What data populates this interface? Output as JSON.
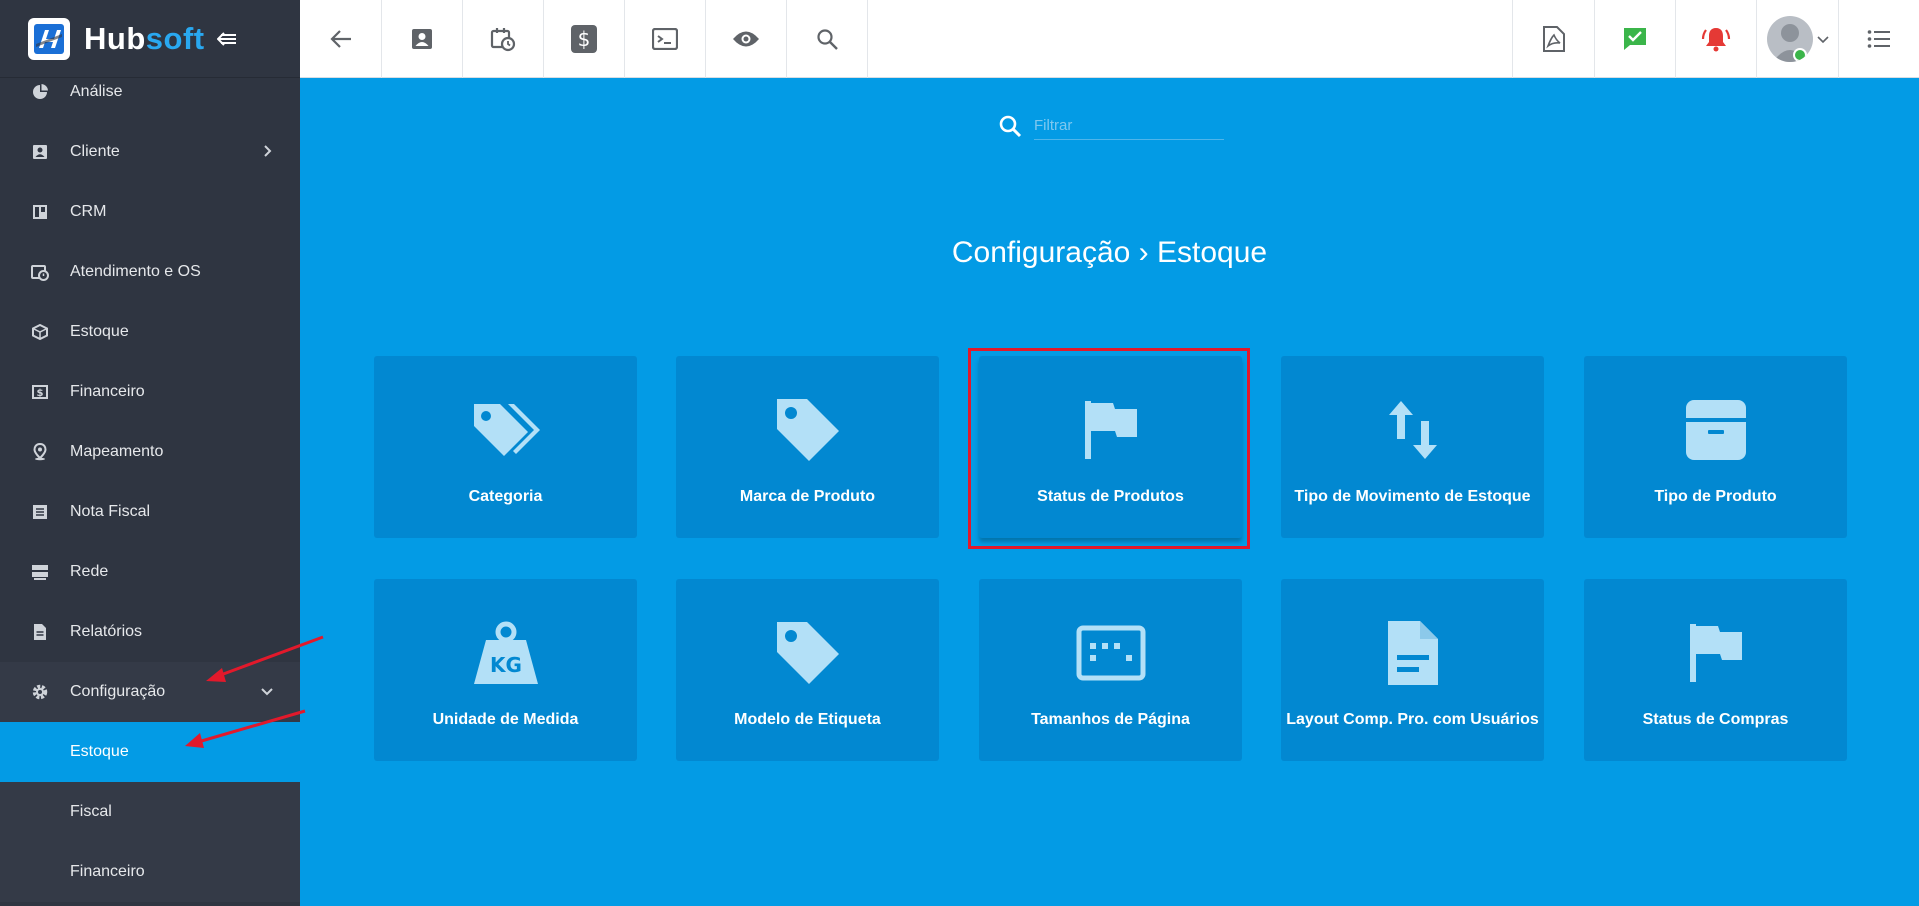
{
  "brand": {
    "hub": "Hub",
    "soft": "soft"
  },
  "sidebar": {
    "items": [
      {
        "label": "Análise",
        "icon": "pie-chart-icon"
      },
      {
        "label": "Cliente",
        "icon": "contact-card-icon"
      },
      {
        "label": "CRM",
        "icon": "kanban-icon"
      },
      {
        "label": "Atendimento e OS",
        "icon": "calendar-clock-icon"
      },
      {
        "label": "Estoque",
        "icon": "box-icon"
      },
      {
        "label": "Financeiro",
        "icon": "money-icon"
      },
      {
        "label": "Mapeamento",
        "icon": "map-pin-icon"
      },
      {
        "label": "Nota Fiscal",
        "icon": "receipt-icon"
      },
      {
        "label": "Rede",
        "icon": "server-icon"
      },
      {
        "label": "Relatórios",
        "icon": "document-icon"
      },
      {
        "label": "Configuração",
        "icon": "gear-icon"
      }
    ],
    "sub_items": [
      {
        "label": "Estoque"
      },
      {
        "label": "Fiscal"
      },
      {
        "label": "Financeiro"
      }
    ]
  },
  "filter": {
    "placeholder": "Filtrar"
  },
  "page": {
    "title": "Configuração › Estoque"
  },
  "cards": [
    {
      "label": "Categoria",
      "icon": "tags-icon"
    },
    {
      "label": "Marca de Produto",
      "icon": "tag-icon"
    },
    {
      "label": "Status de Produtos",
      "icon": "flag-icon"
    },
    {
      "label": "Tipo de Movimento de Estoque",
      "icon": "swap-vertical-icon"
    },
    {
      "label": "Tipo de Produto",
      "icon": "archive-box-icon"
    },
    {
      "label": "Unidade de Medida",
      "icon": "weight-kg-icon",
      "icon_text": "KG"
    },
    {
      "label": "Modelo de Etiqueta",
      "icon": "tag-icon"
    },
    {
      "label": "Tamanhos de Página",
      "icon": "page-size-icon"
    },
    {
      "label": "Layout Comp. Pro. com Usuários",
      "icon": "document-icon"
    },
    {
      "label": "Status de Compras",
      "icon": "flag-icon"
    }
  ],
  "colors": {
    "sidebar": "#2f3541",
    "main": "#039be5",
    "card": "#0288d1",
    "highlight": "#e2192b"
  }
}
